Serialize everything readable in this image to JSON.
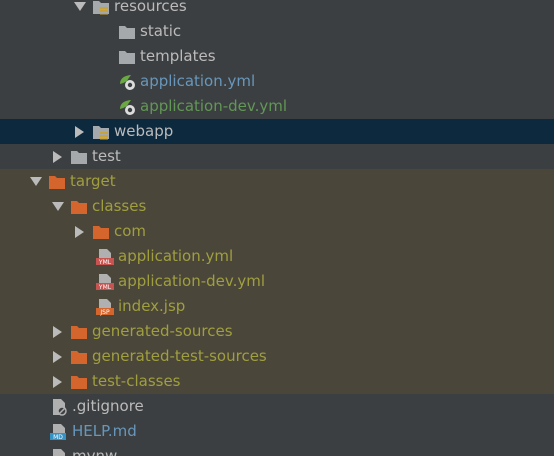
{
  "tree": {
    "items": [
      {
        "label": "resources",
        "icon": "resources-folder-icon",
        "expand": "down",
        "color": "#bbbbbb"
      },
      {
        "label": "static",
        "icon": "folder-icon",
        "expand": "none",
        "color": "#bbbbbb"
      },
      {
        "label": "templates",
        "icon": "folder-icon",
        "expand": "none",
        "color": "#bbbbbb"
      },
      {
        "label": "application.yml",
        "icon": "spring-config-icon",
        "expand": "none",
        "color": "#6897bb"
      },
      {
        "label": "application-dev.yml",
        "icon": "spring-config-icon",
        "expand": "none",
        "color": "#629755"
      },
      {
        "label": "webapp",
        "icon": "web-folder-icon",
        "expand": "right",
        "color": "#bbbbbb"
      },
      {
        "label": "test",
        "icon": "folder-icon",
        "expand": "right",
        "color": "#bbbbbb"
      },
      {
        "label": "target",
        "icon": "excluded-folder-icon",
        "expand": "down",
        "color": "#a09f3f"
      },
      {
        "label": "classes",
        "icon": "excluded-folder-icon",
        "expand": "down",
        "color": "#a09f3f"
      },
      {
        "label": "com",
        "icon": "excluded-folder-icon",
        "expand": "right",
        "color": "#a09f3f"
      },
      {
        "label": "application.yml",
        "icon": "yml-file-icon",
        "expand": "none",
        "color": "#a09f3f"
      },
      {
        "label": "application-dev.yml",
        "icon": "yml-file-icon",
        "expand": "none",
        "color": "#a09f3f"
      },
      {
        "label": "index.jsp",
        "icon": "jsp-file-icon",
        "expand": "none",
        "color": "#a09f3f"
      },
      {
        "label": "generated-sources",
        "icon": "excluded-folder-icon",
        "expand": "right",
        "color": "#a09f3f"
      },
      {
        "label": "generated-test-sources",
        "icon": "excluded-folder-icon",
        "expand": "right",
        "color": "#a09f3f"
      },
      {
        "label": "test-classes",
        "icon": "excluded-folder-icon",
        "expand": "right",
        "color": "#a09f3f"
      },
      {
        "label": ".gitignore",
        "icon": "ignored-file-icon",
        "expand": "none",
        "color": "#bbbbbb"
      },
      {
        "label": "HELP.md",
        "icon": "markdown-file-icon",
        "expand": "none",
        "color": "#6897bb"
      },
      {
        "label": "mvnw",
        "icon": "file-icon",
        "expand": "none",
        "color": "#bbbbbb"
      }
    ],
    "file_badges": {
      "yml": "YML",
      "jsp": "JSP",
      "md": "MD"
    },
    "colors": {
      "background": "#3c3f41",
      "selected_row": "#0d293e",
      "excluded_row": "#4a463a",
      "folder": "#a6a9ab",
      "excluded_folder": "#d4662d",
      "spring_green": "#6aa843"
    }
  }
}
